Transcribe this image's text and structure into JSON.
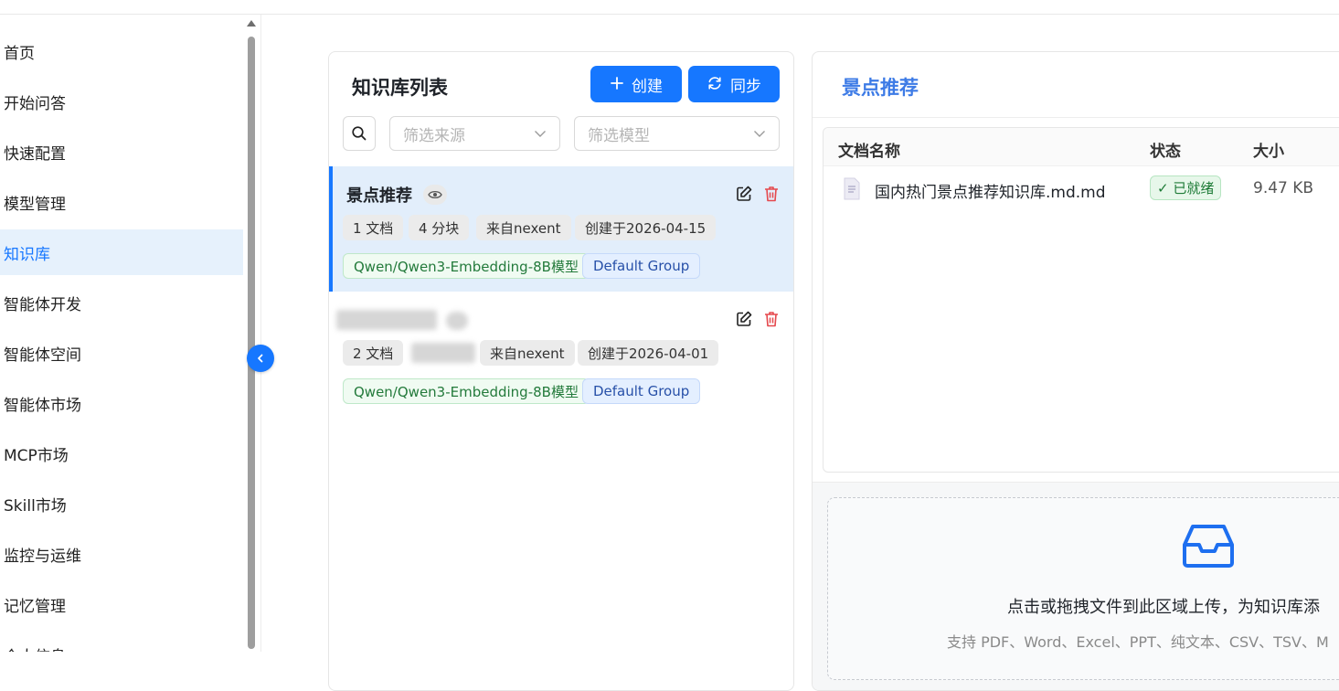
{
  "sidebar": {
    "items": [
      {
        "label": "首页"
      },
      {
        "label": "开始问答"
      },
      {
        "label": "快速配置"
      },
      {
        "label": "模型管理"
      },
      {
        "label": "知识库",
        "active": true
      },
      {
        "label": "智能体开发"
      },
      {
        "label": "智能体空间"
      },
      {
        "label": "智能体市场"
      },
      {
        "label": "MCP市场"
      },
      {
        "label": "Skill市场"
      },
      {
        "label": "监控与运维"
      },
      {
        "label": "记忆管理"
      },
      {
        "label": "个人信息"
      }
    ],
    "collapse_icon": "chevron-left-icon"
  },
  "kb_list": {
    "title": "知识库列表",
    "create_label": "创建",
    "sync_label": "同步",
    "source_filter_placeholder": "筛选来源",
    "model_filter_placeholder": "筛选模型",
    "cards": [
      {
        "name": "景点推荐",
        "docs": "1 文档",
        "chunks": "4 分块",
        "source": "来自nexent",
        "created": "创建于2026-04-15",
        "model": "Qwen/Qwen3-Embedding-8B模型",
        "group": "Default Group"
      },
      {
        "name": "",
        "docs": "2 文档",
        "chunks": "",
        "source": "来自nexent",
        "created": "创建于2026-04-01",
        "model": "Qwen/Qwen3-Embedding-8B模型",
        "group": "Default Group"
      }
    ]
  },
  "detail": {
    "title": "景点推荐",
    "columns": [
      "文档名称",
      "状态",
      "大小"
    ],
    "rows": [
      {
        "name": "国内热门景点推荐知识库.md.md",
        "status": "✓ 已就绪",
        "size": "9.47 KB"
      }
    ],
    "upload_text": "点击或拖拽文件到此区域上传，为知识库添",
    "upload_hint": "支持 PDF、Word、Excel、PPT、纯文本、CSV、TSV、M"
  },
  "colors": {
    "accent": "#1677ff",
    "active_bg": "#e6f1fc",
    "delete": "#e5484d",
    "ready": "#1e7b37"
  }
}
